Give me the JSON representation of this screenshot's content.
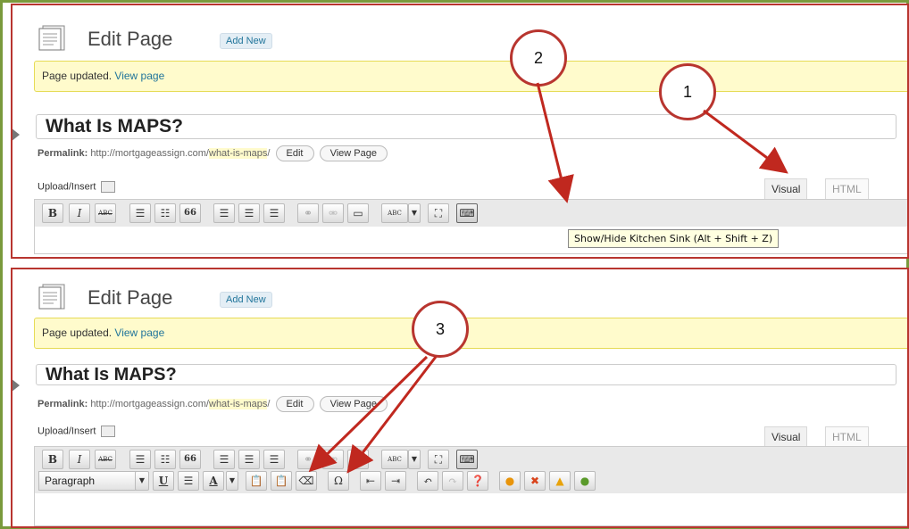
{
  "panel_top": {
    "title": "Edit Page",
    "add_new": "Add New",
    "notice_text": "Page updated.",
    "notice_link": "View page",
    "page_title": "What Is MAPS?",
    "permalink_label": "Permalink:",
    "permalink_base": "http://mortgageassign.com/",
    "permalink_slug": "what-is-maps",
    "permalink_end": "/",
    "edit_btn": "Edit",
    "view_page_btn": "View Page",
    "upload_insert": "Upload/Insert",
    "tab_visual": "Visual",
    "tab_html": "HTML",
    "tooltip": "Show/Hide Kitchen Sink (Alt + Shift + Z)"
  },
  "panel_bottom": {
    "title": "Edit Page",
    "add_new": "Add New",
    "notice_text": "Page updated.",
    "notice_link": "View page",
    "page_title": "What Is MAPS?",
    "permalink_label": "Permalink:",
    "permalink_base": "http://mortgageassign.com/",
    "permalink_slug": "what-is-maps",
    "permalink_end": "/",
    "edit_btn": "Edit",
    "view_page_btn": "View Page",
    "upload_insert": "Upload/Insert",
    "tab_visual": "Visual",
    "tab_html": "HTML",
    "format_select": "Paragraph"
  },
  "toolbar": {
    "bold": "B",
    "italic": "I",
    "strike": "ABC",
    "blockquote": "66",
    "spellcheck": "ABC",
    "underline": "U",
    "text_color": "A",
    "omega": "Ω"
  },
  "callouts": {
    "one": "1",
    "two": "2",
    "three": "3"
  },
  "colors": {
    "frame_border": "#7a9a3c",
    "panel_border": "#b8352f",
    "notice_bg": "#fffbcc",
    "link": "#21759b"
  }
}
